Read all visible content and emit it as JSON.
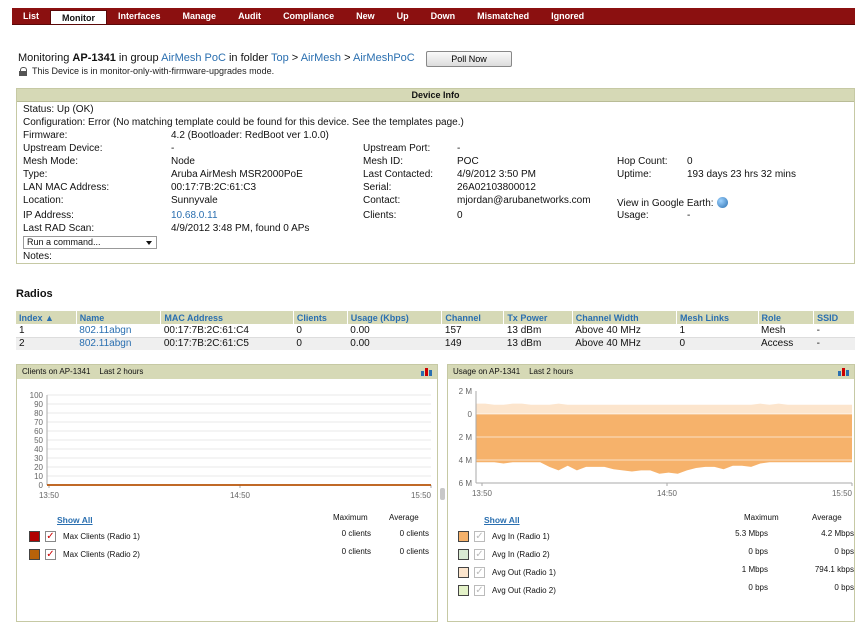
{
  "nav": [
    "List",
    "Monitor",
    "Interfaces",
    "Manage",
    "Audit",
    "Compliance",
    "New",
    "Up",
    "Down",
    "Mismatched",
    "Ignored"
  ],
  "header": {
    "prefix": "Monitoring",
    "device": "AP-1341",
    "in_group": "in group",
    "group": "AirMesh PoC",
    "in_folder": "in folder",
    "folder_top": "Top",
    "sep": ">",
    "folder_mid": "AirMesh",
    "folder_leaf": "AirMeshPoC",
    "poll_label": "Poll Now",
    "mode_note": "This Device is in monitor-only-with-firmware-upgrades mode."
  },
  "device_info": {
    "title": "Device Info",
    "status": "Status: Up (OK)",
    "configuration": "Configuration: Error (No matching template could be found for this device. See the templates page.)",
    "firmware_label": "Firmware:",
    "firmware": "4.2 (Bootloader: RedBoot ver 1.0.0)",
    "upstream_device_label": "Upstream Device:",
    "upstream_device": "-",
    "upstream_port_label": "Upstream Port:",
    "upstream_port": "-",
    "mesh_mode_label": "Mesh Mode:",
    "mesh_mode": "Node",
    "mesh_id_label": "Mesh ID:",
    "mesh_id": "POC",
    "hop_count_label": "Hop Count:",
    "hop_count": "0",
    "type_label": "Type:",
    "type": "Aruba AirMesh MSR2000PoE",
    "last_contacted_label": "Last Contacted:",
    "last_contacted": "4/9/2012 3:50 PM",
    "uptime_label": "Uptime:",
    "uptime": "193 days 23 hrs 32 mins",
    "lan_mac_label": "LAN MAC Address:",
    "lan_mac": "00:17:7B:2C:61:C3",
    "serial_label": "Serial:",
    "serial": "26A02103800012",
    "location_label": "Location:",
    "location": "Sunnyvale",
    "contact_label": "Contact:",
    "contact": "mjordan@arubanetworks.com",
    "google_earth": "View in Google Earth:",
    "ip_label": "IP Address:",
    "ip": "10.68.0.11",
    "clients_label": "Clients:",
    "clients": "0",
    "usage_label": "Usage:",
    "usage": "-",
    "rad_scan_label": "Last RAD Scan:",
    "rad_scan": "4/9/2012 3:48 PM, found 0 APs",
    "command_placeholder": "Run a command...",
    "notes_label": "Notes:"
  },
  "radios": {
    "title": "Radios",
    "columns": [
      "Index ▲",
      "Name",
      "MAC Address",
      "Clients",
      "Usage (Kbps)",
      "Channel",
      "Tx Power",
      "Channel Width",
      "Mesh Links",
      "Role",
      "SSID"
    ],
    "rows": [
      [
        "1",
        "802.11abgn",
        "00:17:7B:2C:61:C4",
        "0",
        "0.00",
        "157",
        "13 dBm",
        "Above 40 MHz",
        "1",
        "Mesh",
        "-"
      ],
      [
        "2",
        "802.11abgn",
        "00:17:7B:2C:61:C5",
        "0",
        "0.00",
        "149",
        "13 dBm",
        "Above 40 MHz",
        "0",
        "Access",
        "-"
      ]
    ]
  },
  "clients_chart": {
    "title": "Clients on AP-1341",
    "range": "Last 2 hours",
    "show_all": "Show All",
    "max_header": "Maximum",
    "avg_header": "Average",
    "legend": [
      {
        "label": "Max Clients (Radio 1)",
        "color": "#b00000",
        "max": "0 clients",
        "avg": "0 clients"
      },
      {
        "label": "Max Clients (Radio 2)",
        "color": "#b8620a",
        "max": "0 clients",
        "avg": "0 clients"
      }
    ]
  },
  "usage_chart": {
    "title": "Usage on AP-1341",
    "range": "Last 2 hours",
    "show_all": "Show All",
    "max_header": "Maximum",
    "avg_header": "Average",
    "legend": [
      {
        "label": "Avg In (Radio 1)",
        "color": "#f6b26b",
        "max": "5.3 Mbps",
        "avg": "4.2 Mbps"
      },
      {
        "label": "Avg In (Radio 2)",
        "color": "#d9ead3",
        "max": "0 bps",
        "avg": "0 bps"
      },
      {
        "label": "Avg Out (Radio 1)",
        "color": "#fce5cd",
        "max": "1 Mbps",
        "avg": "794.1 kbps"
      },
      {
        "label": "Avg Out (Radio 2)",
        "color": "#e4f2c8",
        "max": "0 bps",
        "avg": "0 bps"
      }
    ]
  },
  "chart_data": [
    {
      "type": "line",
      "title": "Clients on AP-1341",
      "subtitle": "Last 2 hours",
      "xlabel": "",
      "ylabel": "",
      "x_ticks": [
        "13:50",
        "14:50",
        "15:50"
      ],
      "y_ticks": [
        0,
        10,
        20,
        30,
        40,
        50,
        60,
        70,
        80,
        90,
        100
      ],
      "ylim": [
        0,
        100
      ],
      "grid": true,
      "series": [
        {
          "name": "Max Clients (Radio 1)",
          "values": [
            0,
            0,
            0
          ]
        },
        {
          "name": "Max Clients (Radio 2)",
          "values": [
            0,
            0,
            0
          ]
        }
      ]
    },
    {
      "type": "area",
      "title": "Usage on AP-1341",
      "subtitle": "Last 2 hours",
      "xlabel": "",
      "ylabel": "",
      "x_ticks": [
        "13:50",
        "14:50",
        "15:50"
      ],
      "y_ticks": [
        "2 M",
        "0",
        "2 M",
        "4 M",
        "6 M"
      ],
      "y_tick_values": [
        2,
        0,
        -2,
        -4,
        -6
      ],
      "ylim": [
        -6,
        2
      ],
      "grid": true,
      "series": [
        {
          "name": "Avg Out (Radio 1)",
          "values": [
            0.9,
            0.9,
            0.8,
            0.8,
            0.9,
            0.9,
            0.8,
            0.8,
            0.8,
            0.9,
            0.8,
            0.8,
            0.8,
            0.8,
            0.8,
            0.8,
            0.8,
            0.8,
            0.8,
            0.8,
            0.8,
            0.8,
            0.8,
            0.8,
            0.8,
            0.8,
            0.8,
            0.8,
            0.8,
            0.8,
            0.8,
            0.9,
            0.8,
            0.9,
            0.8,
            0.8,
            0.8,
            0.8,
            0.8,
            0.8,
            0.8,
            0.8
          ]
        },
        {
          "name": "Avg In (Radio 1)",
          "values": [
            -4.2,
            -4.2,
            -4.2,
            -4.3,
            -4.2,
            -4.2,
            -4.2,
            -4.2,
            -4.6,
            -4.9,
            -4.5,
            -4.9,
            -4.6,
            -4.6,
            -4.6,
            -4.8,
            -4.9,
            -5.0,
            -4.9,
            -4.9,
            -5.2,
            -5.1,
            -5.2,
            -4.9,
            -4.7,
            -4.6,
            -4.6,
            -4.8,
            -4.5,
            -4.5,
            -4.6,
            -4.3,
            -4.2,
            -4.2,
            -4.2,
            -4.2,
            -4.2,
            -4.2,
            -4.2,
            -4.2,
            -4.2,
            -4.2
          ]
        }
      ]
    }
  ]
}
